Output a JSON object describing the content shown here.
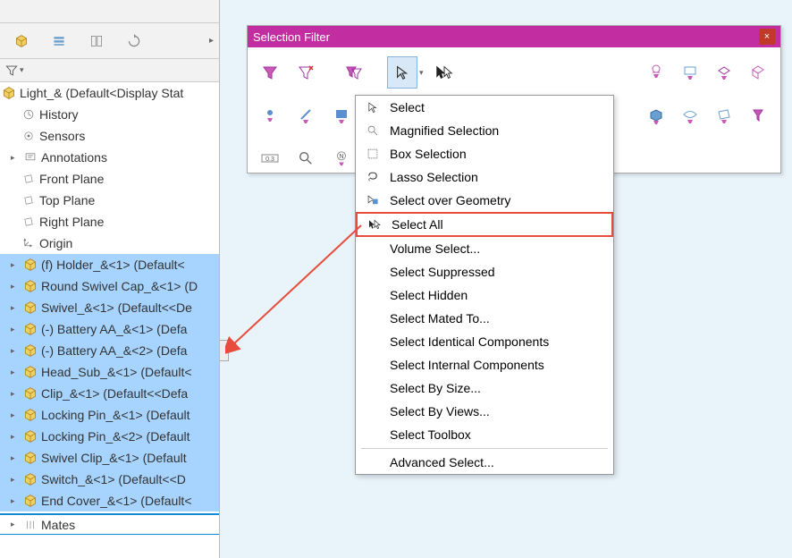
{
  "selection_filter": {
    "title": "Selection Filter",
    "close": "×"
  },
  "tree": {
    "root": "Light_&  (Default<Display Stat",
    "history": "History",
    "sensors": "Sensors",
    "annotations": "Annotations",
    "front_plane": "Front Plane",
    "top_plane": "Top Plane",
    "right_plane": "Right Plane",
    "origin": "Origin",
    "parts": [
      "(f) Holder_&<1> (Default<",
      "Round Swivel Cap_&<1> (D",
      "Swivel_&<1> (Default<<De",
      "(-) Battery AA_&<1> (Defa",
      "(-) Battery AA_&<2> (Defa",
      "Head_Sub_&<1> (Default<",
      "Clip_&<1> (Default<<Defa",
      "Locking Pin_&<1> (Default",
      "Locking Pin_&<2> (Default",
      "Swivel Clip_&<1> (Default",
      "Switch_&<1> (Default<<D",
      "End Cover_&<1> (Default<"
    ],
    "mates": "Mates"
  },
  "dropdown": {
    "items": [
      "Select",
      "Magnified Selection",
      "Box Selection",
      "Lasso Selection",
      "Select over Geometry",
      "Select All",
      "Volume Select...",
      "Select Suppressed",
      "Select Hidden",
      "Select Mated To...",
      "Select Identical Components",
      "Select Internal Components",
      "Select By Size...",
      "Select By Views...",
      "Select Toolbox",
      "Advanced Select..."
    ]
  }
}
